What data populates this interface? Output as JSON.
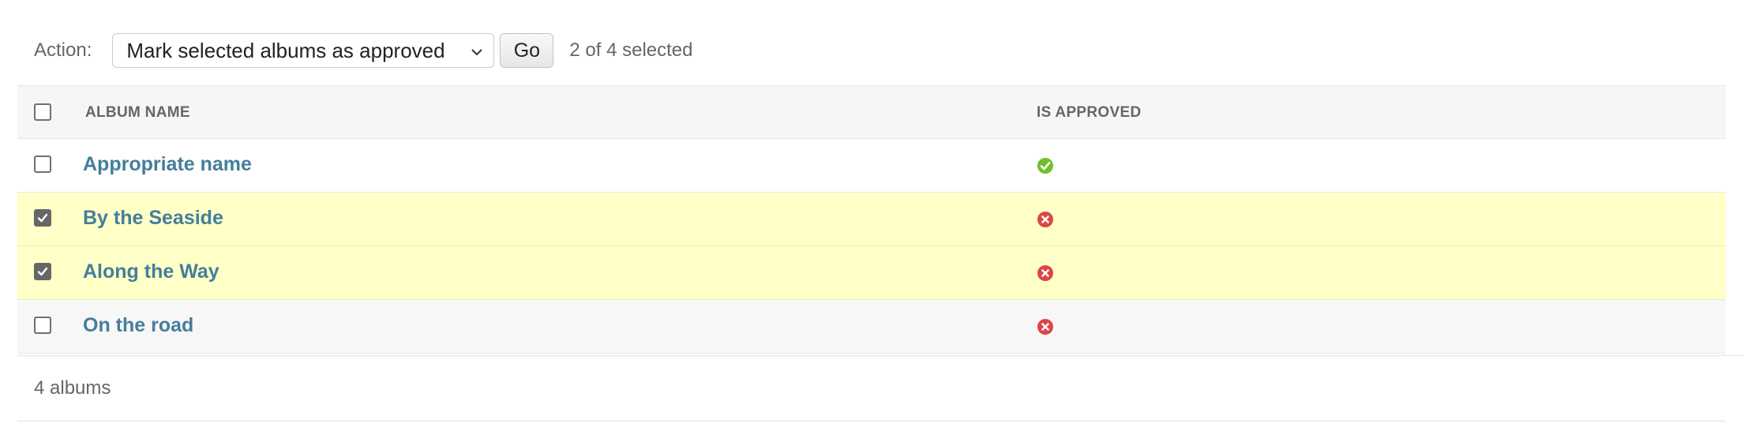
{
  "actions": {
    "label": "Action:",
    "selected_option": "Mark selected albums as approved",
    "go_label": "Go",
    "selection_status": "2 of 4 selected"
  },
  "table": {
    "headers": {
      "album_name": "ALBUM NAME",
      "is_approved": "IS APPROVED"
    },
    "rows": [
      {
        "name": "Appropriate name",
        "is_approved": true,
        "selected": false
      },
      {
        "name": "By the Seaside",
        "is_approved": false,
        "selected": true
      },
      {
        "name": "Along the Way",
        "is_approved": false,
        "selected": true
      },
      {
        "name": "On the road",
        "is_approved": false,
        "selected": false
      }
    ]
  },
  "paginator": {
    "count_text": "4 albums"
  },
  "icons": {
    "approved": "check-circle-icon",
    "not_approved": "x-circle-icon",
    "dropdown": "chevron-down-icon"
  },
  "colors": {
    "link": "#447e9b",
    "approved_green": "#70bf2b",
    "not_approved_red": "#dd4646",
    "selected_row_bg": "#ffffc8",
    "header_bg": "#f6f6f6"
  }
}
